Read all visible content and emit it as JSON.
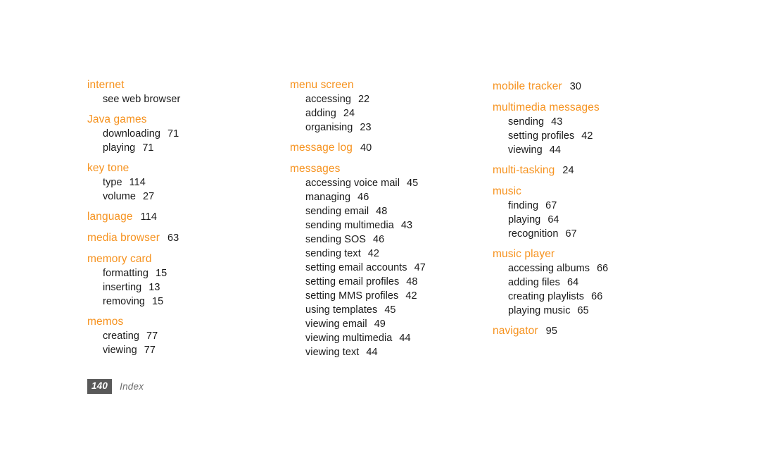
{
  "page": {
    "footer_number": "140",
    "footer_label": "Index",
    "heading_color": "#F6921E",
    "text_color": "#1a1a1a",
    "footer_badge_color": "#595959",
    "background_color": "#ffffff"
  },
  "columns": [
    {
      "groups": [
        {
          "heading": "internet",
          "heading_page": "",
          "entries": [
            {
              "label": "see web browser",
              "page": ""
            }
          ]
        },
        {
          "heading": "Java games",
          "heading_page": "",
          "entries": [
            {
              "label": "downloading",
              "page": "71"
            },
            {
              "label": "playing",
              "page": "71"
            }
          ]
        },
        {
          "heading": "key tone",
          "heading_page": "",
          "entries": [
            {
              "label": "type",
              "page": "114"
            },
            {
              "label": "volume",
              "page": "27"
            }
          ]
        },
        {
          "heading": "language",
          "heading_page": "114",
          "entries": []
        },
        {
          "heading": "media browser",
          "heading_page": "63",
          "entries": []
        },
        {
          "heading": "memory card",
          "heading_page": "",
          "entries": [
            {
              "label": "formatting",
              "page": "15"
            },
            {
              "label": "inserting",
              "page": "13"
            },
            {
              "label": "removing",
              "page": "15"
            }
          ]
        },
        {
          "heading": "memos",
          "heading_page": "",
          "entries": [
            {
              "label": "creating",
              "page": "77"
            },
            {
              "label": "viewing",
              "page": "77"
            }
          ]
        }
      ]
    },
    {
      "groups": [
        {
          "heading": "menu screen",
          "heading_page": "",
          "entries": [
            {
              "label": "accessing",
              "page": "22"
            },
            {
              "label": "adding",
              "page": "24"
            },
            {
              "label": "organising",
              "page": "23"
            }
          ]
        },
        {
          "heading": "message log",
          "heading_page": "40",
          "entries": []
        },
        {
          "heading": "messages",
          "heading_page": "",
          "entries": [
            {
              "label": "accessing voice mail",
              "page": "45"
            },
            {
              "label": "managing",
              "page": "46"
            },
            {
              "label": "sending email",
              "page": "48"
            },
            {
              "label": "sending multimedia",
              "page": "43"
            },
            {
              "label": "sending SOS",
              "page": "46"
            },
            {
              "label": "sending text",
              "page": "42"
            },
            {
              "label": "setting email accounts",
              "page": "47"
            },
            {
              "label": "setting email profiles",
              "page": "48"
            },
            {
              "label": "setting MMS profiles",
              "page": "42"
            },
            {
              "label": "using templates",
              "page": "45"
            },
            {
              "label": "viewing email",
              "page": "49"
            },
            {
              "label": "viewing multimedia",
              "page": "44"
            },
            {
              "label": "viewing text",
              "page": "44"
            }
          ]
        }
      ]
    },
    {
      "groups": [
        {
          "heading": "mobile tracker",
          "heading_page": "30",
          "entries": []
        },
        {
          "heading": "multimedia messages",
          "heading_page": "",
          "entries": [
            {
              "label": "sending",
              "page": "43"
            },
            {
              "label": "setting profiles",
              "page": "42"
            },
            {
              "label": "viewing",
              "page": "44"
            }
          ]
        },
        {
          "heading": "multi-tasking",
          "heading_page": "24",
          "entries": []
        },
        {
          "heading": "music",
          "heading_page": "",
          "entries": [
            {
              "label": "finding",
              "page": "67"
            },
            {
              "label": "playing",
              "page": "64"
            },
            {
              "label": "recognition",
              "page": "67"
            }
          ]
        },
        {
          "heading": "music player",
          "heading_page": "",
          "entries": [
            {
              "label": "accessing albums",
              "page": "66"
            },
            {
              "label": "adding files",
              "page": "64"
            },
            {
              "label": "creating playlists",
              "page": "66"
            },
            {
              "label": "playing music",
              "page": "65"
            }
          ]
        },
        {
          "heading": "navigator",
          "heading_page": "95",
          "entries": []
        }
      ]
    }
  ]
}
